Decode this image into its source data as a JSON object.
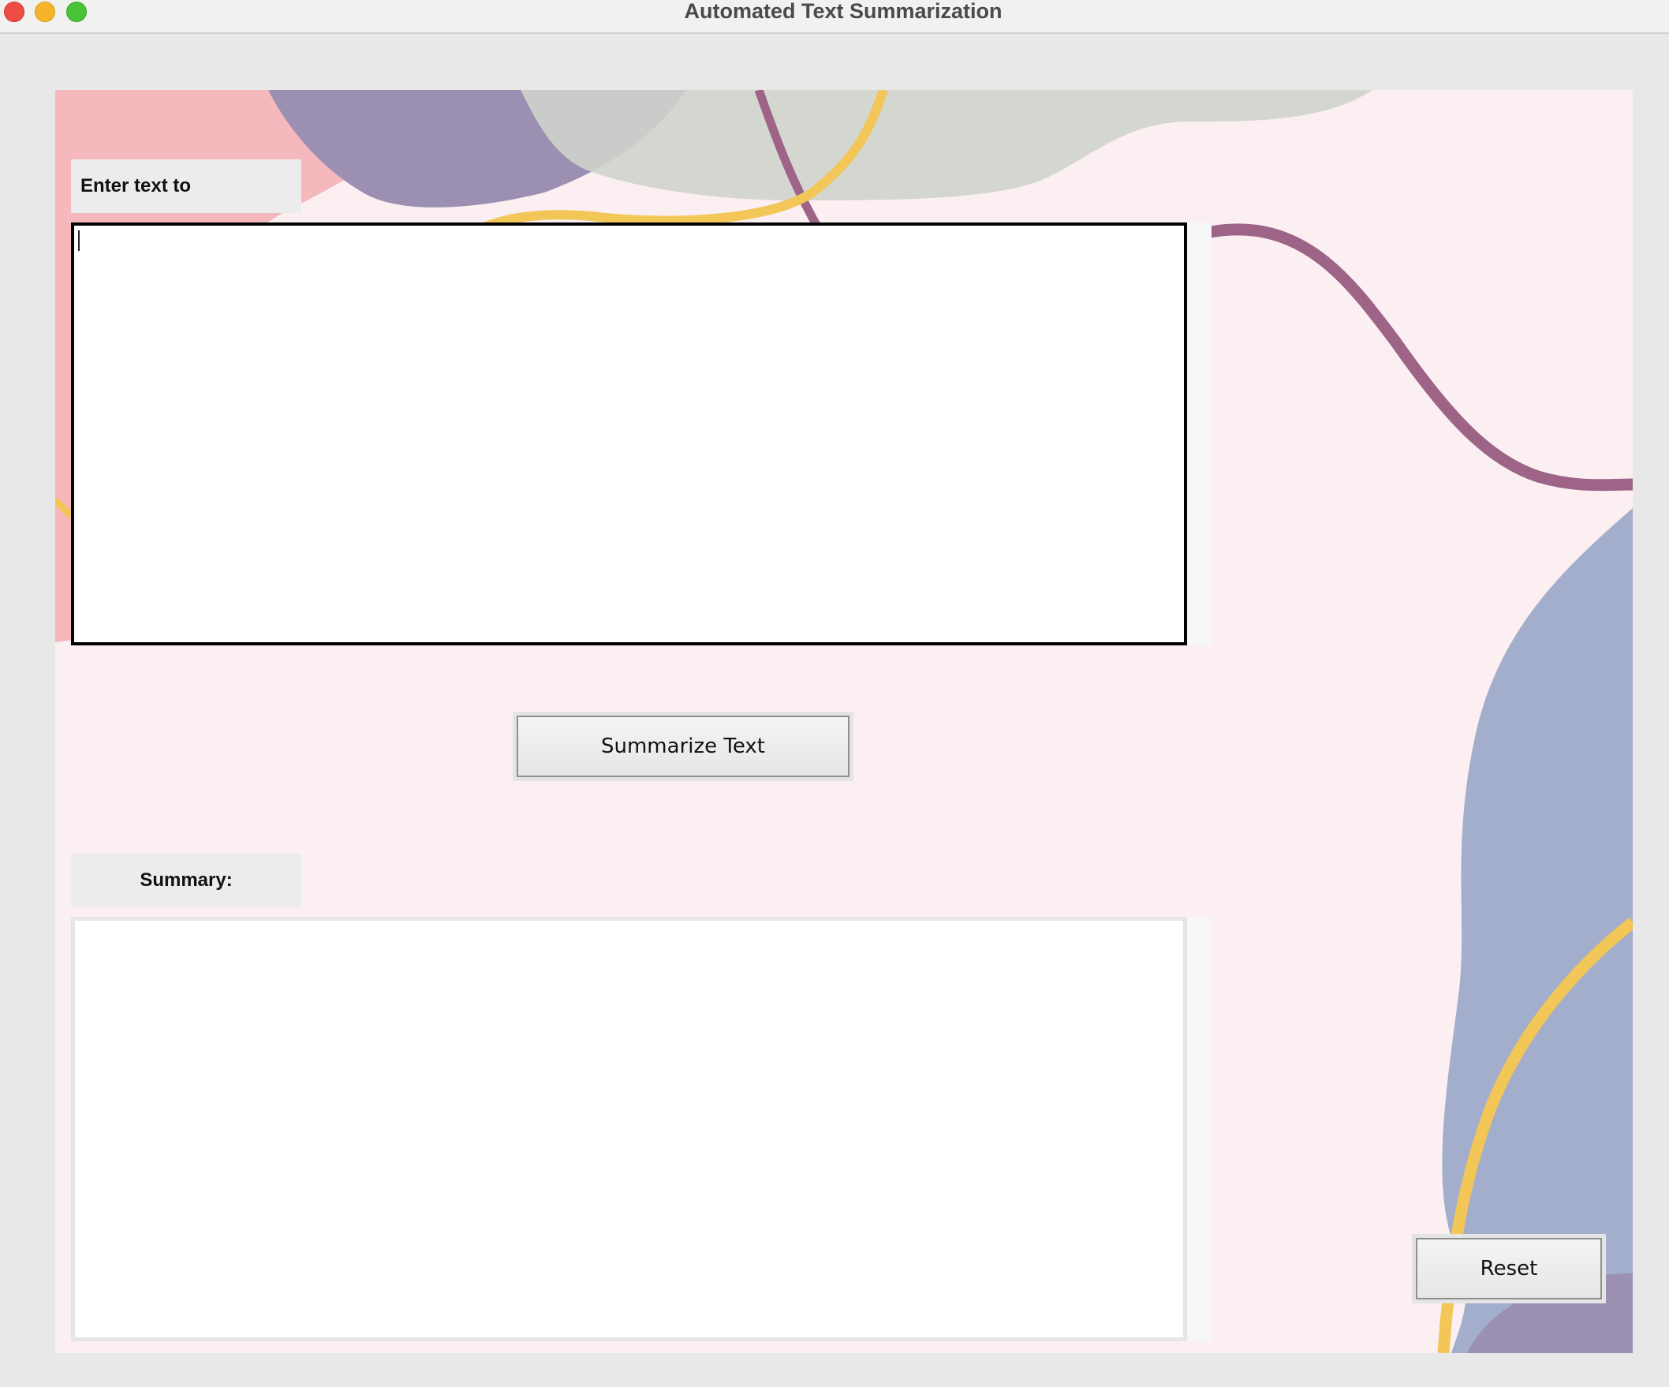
{
  "window": {
    "title": "Automated Text Summarization"
  },
  "input": {
    "label": "Enter text to summarize:",
    "value": "",
    "placeholder": ""
  },
  "actions": {
    "summarize_label": "Summarize Text",
    "reset_label": "Reset"
  },
  "output": {
    "label": "Summary:",
    "value": ""
  },
  "colors": {
    "background": "#fbeff1",
    "blob_pink": "#f4b8bd",
    "blob_purple": "#9b90b1",
    "blob_gray": "#d5d8d3",
    "blob_blue": "#a3adcc",
    "line_mauve": "#9e6488",
    "line_yellow": "#f2c657"
  }
}
